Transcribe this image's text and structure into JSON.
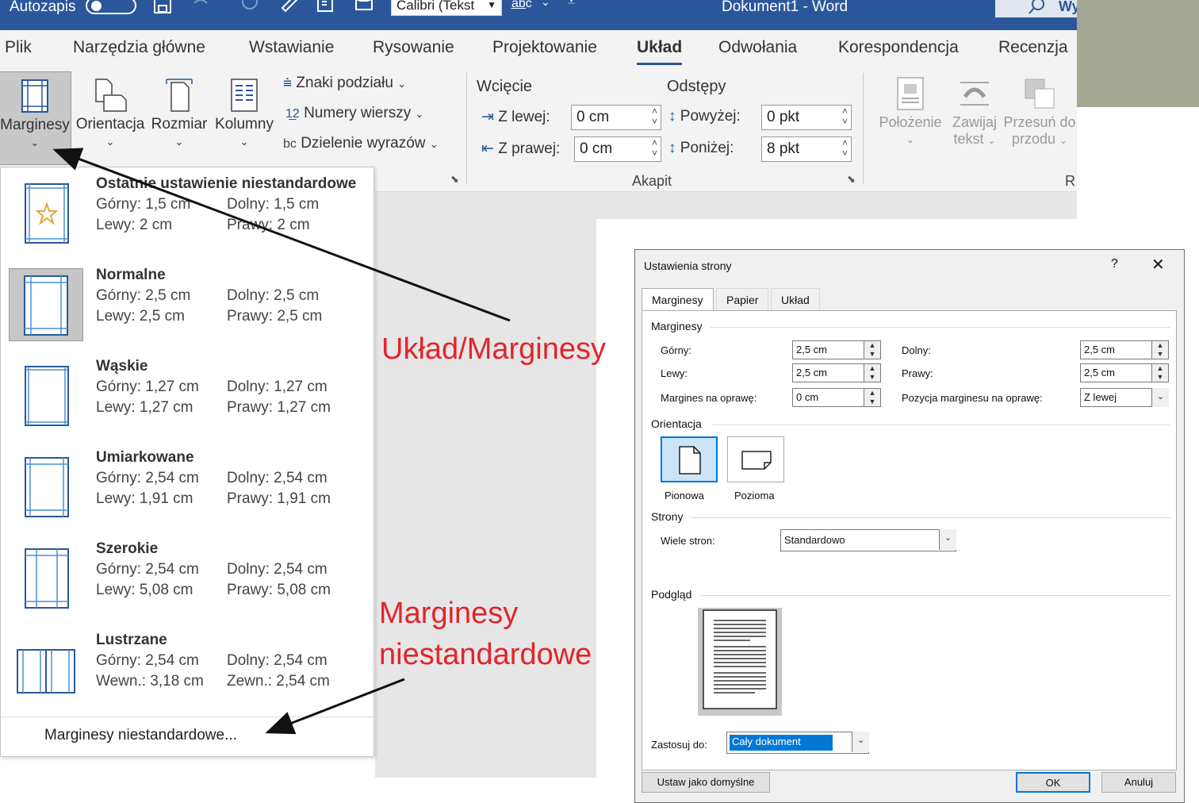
{
  "titlebar": {
    "autosave_label": "Autozapis",
    "font_box": "Calibri (Tekst",
    "title": "Dokument1  -  Word",
    "search_label": "Wy"
  },
  "tabs": [
    "Plik",
    "Narzędzia główne",
    "Wstawianie",
    "Rysowanie",
    "Projektowanie",
    "Układ",
    "Odwołania",
    "Korespondencja",
    "Recenzja"
  ],
  "active_tab": "Układ",
  "ribbon": {
    "margins": "Marginesy",
    "orientation": "Orientacja",
    "size": "Rozmiar",
    "columns": "Kolumny",
    "breaks": "Znaki podziału",
    "line_numbers": "Numery wierszy",
    "hyphenation": "Dzielenie wyrazów",
    "indent_header": "Wcięcie",
    "spacing_header": "Odstępy",
    "indent_left_label": "Z lewej:",
    "indent_left_value": "0 cm",
    "indent_right_label": "Z prawej:",
    "indent_right_value": "0 cm",
    "spacing_before_label": "Powyżej:",
    "spacing_before_value": "0 pkt",
    "spacing_after_label": "Poniżej:",
    "spacing_after_value": "8 pkt",
    "paragraph_group": "Akapit",
    "position": "Położenie",
    "wrap_text_1": "Zawijaj",
    "wrap_text_2": "tekst",
    "bring_forward_1": "Przesuń do",
    "bring_forward_2": "przodu",
    "arrange_group_partial": "R"
  },
  "margins_menu": {
    "items": [
      {
        "title": "Ostatnie ustawienie niestandardowe",
        "l1a": "Górny:  1,5 cm",
        "l1b": "Dolny:  1,5 cm",
        "l2a": "Lewy:  2 cm",
        "l2b": "Prawy: 2 cm"
      },
      {
        "title": "Normalne",
        "l1a": "Górny:  2,5 cm",
        "l1b": "Dolny:  2,5 cm",
        "l2a": "Lewy:   2,5 cm",
        "l2b": "Prawy:  2,5 cm"
      },
      {
        "title": "Wąskie",
        "l1a": "Górny:  1,27 cm",
        "l1b": "Dolny:  1,27 cm",
        "l2a": "Lewy:   1,27 cm",
        "l2b": "Prawy:  1,27 cm"
      },
      {
        "title": "Umiarkowane",
        "l1a": "Górny:  2,54 cm",
        "l1b": "Dolny:  2,54 cm",
        "l2a": "Lewy:   1,91 cm",
        "l2b": "Prawy:  1,91 cm"
      },
      {
        "title": "Szerokie",
        "l1a": "Górny:  2,54 cm",
        "l1b": "Dolny:  2,54 cm",
        "l2a": "Lewy:   5,08 cm",
        "l2b": "Prawy:  5,08 cm"
      },
      {
        "title": "Lustrzane",
        "l1a": "Górny:  2,54 cm",
        "l1b": "Dolny:  2,54 cm",
        "l2a": "Wewn.: 3,18 cm",
        "l2b": "Zewn.:  2,54 cm"
      }
    ],
    "footer": "Marginesy niestandardowe..."
  },
  "annotations": {
    "layout_margins": "Układ/Marginesy",
    "custom_1": "Marginesy",
    "custom_2": "niestandardowe"
  },
  "dialog": {
    "title": "Ustawienia strony",
    "help": "?",
    "close": "✕",
    "tabs": [
      "Marginesy",
      "Papier",
      "Układ"
    ],
    "margins_section": "Marginesy",
    "top_label": "Górny:",
    "top_value": "2,5 cm",
    "bottom_label": "Dolny:",
    "bottom_value": "2,5 cm",
    "left_label": "Lewy:",
    "left_value": "2,5 cm",
    "right_label": "Prawy:",
    "right_value": "2,5 cm",
    "gutter_label": "Margines na oprawę:",
    "gutter_value": "0 cm",
    "gutter_pos_label": "Pozycja marginesu na oprawę:",
    "gutter_pos_value": "Z lewej",
    "orientation_section": "Orientacja",
    "portrait": "Pionowa",
    "landscape": "Pozioma",
    "pages_section": "Strony",
    "multiple_pages_label": "Wiele stron:",
    "multiple_pages_value": "Standardowo",
    "preview_section": "Podgląd",
    "apply_to_label": "Zastosuj do:",
    "apply_to_value": "Cały dokument",
    "set_default": "Ustaw jako domyślne",
    "ok": "OK",
    "cancel": "Anuluj"
  },
  "colors": {
    "titlebar": "#2b579a",
    "annotation": "#e3242b",
    "accent": "#0078d7"
  }
}
